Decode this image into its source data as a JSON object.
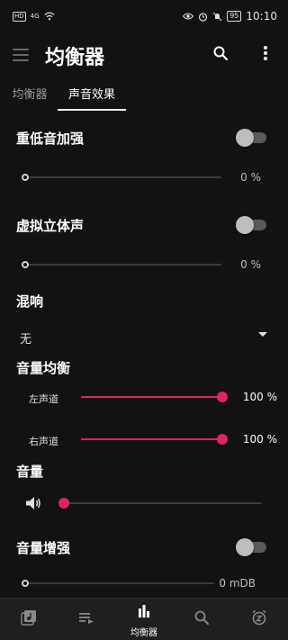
{
  "status_bar": {
    "network_badge": "HD",
    "signal": "4G",
    "battery": "95",
    "time": "10:10"
  },
  "app_bar": {
    "title": "均衡器"
  },
  "tabs": [
    {
      "label": "均衡器",
      "selected": false
    },
    {
      "label": "声音效果",
      "selected": true
    }
  ],
  "bass_boost": {
    "label": "重低音加强",
    "enabled": false,
    "value": "0 %",
    "level": 0
  },
  "virtualizer": {
    "label": "虚拟立体声",
    "enabled": false,
    "value": "0 %",
    "level": 0
  },
  "reverb": {
    "label": "混响",
    "selected": "无"
  },
  "balance": {
    "label": "音量均衡",
    "left_label": "左声道",
    "left_value": "100 %",
    "left_level": 1.0,
    "right_label": "右声道",
    "right_value": "100 %",
    "right_level": 1.0
  },
  "volume": {
    "label": "音量",
    "level": 0,
    "icon": "speaker-icon"
  },
  "loudness": {
    "label": "音量增强",
    "enabled": false,
    "value": "0 mDB",
    "level": 0
  },
  "bottom_nav": {
    "items": [
      {
        "icon": "music-library-icon",
        "label": ""
      },
      {
        "icon": "playlist-icon",
        "label": ""
      },
      {
        "icon": "equalizer-icon",
        "label": "均衡器"
      },
      {
        "icon": "search-icon",
        "label": ""
      },
      {
        "icon": "sleep-timer-icon",
        "label": ""
      }
    ],
    "active_index": 2
  },
  "colors": {
    "accent": "#e0245e",
    "background": "#121212",
    "bottom_nav": "#1f1f1f"
  }
}
